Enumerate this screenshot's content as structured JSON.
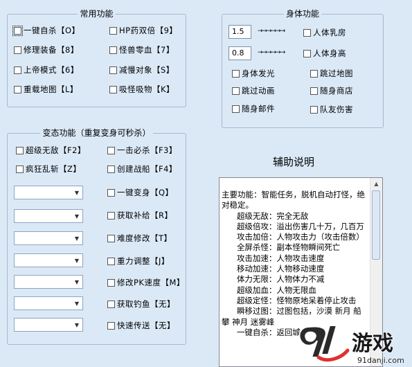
{
  "common": {
    "title": "常用功能",
    "items": [
      {
        "label": "一键自杀【O】",
        "checked": false
      },
      {
        "label": "HP药双倍【9】",
        "checked": false
      },
      {
        "label": "修理装备【8】",
        "checked": false
      },
      {
        "label": "怪兽零血【7】",
        "checked": false
      },
      {
        "label": "上帝模式【6】",
        "checked": false
      },
      {
        "label": "减慢对象【S】",
        "checked": false
      },
      {
        "label": "重载地图【L】",
        "checked": false
      },
      {
        "label": "吸怪吸物【K】",
        "checked": false
      }
    ]
  },
  "body_func": {
    "title": "身体功能",
    "breast_value": "1.5",
    "height_value": "0.8",
    "arrows": "→→→→→→",
    "items": [
      {
        "label": "人体乳房",
        "checked": false
      },
      {
        "label": "人体身高",
        "checked": false
      },
      {
        "label": "身体发光",
        "checked": false
      },
      {
        "label": "跳过地图",
        "checked": false
      },
      {
        "label": "跳过动画",
        "checked": false
      },
      {
        "label": "随身商店",
        "checked": false
      },
      {
        "label": "随身邮件",
        "checked": false
      },
      {
        "label": "队友伤害",
        "checked": false
      }
    ]
  },
  "abnormal": {
    "title": "变态功能（重复变身可秒杀）",
    "items": [
      {
        "label": "超级无敌【F2】",
        "checked": false
      },
      {
        "label": "一击必杀【F3】",
        "checked": false
      },
      {
        "label": "疯狂乱斩【Z】",
        "checked": false
      },
      {
        "label": "创建战船【F4】",
        "checked": false
      },
      {
        "label": "一键变身【Q】",
        "checked": false
      },
      {
        "label": "获取补给【R】",
        "checked": false
      },
      {
        "label": "难度修改【T】",
        "checked": false
      },
      {
        "label": "重力调整【J】",
        "checked": false
      },
      {
        "label": "修改PK速度【M】",
        "checked": false
      },
      {
        "label": "获取钓鱼【无】",
        "checked": false
      },
      {
        "label": "快速传送【无】",
        "checked": false
      }
    ],
    "combo_values": [
      "",
      "",
      "",
      "",
      "",
      "",
      "",
      ""
    ]
  },
  "help": {
    "title": "辅助说明",
    "text": "主要功能：智能任务，脱机自动打怪，绝对稳定。\n      超级无敌：完全无敌\n      超级倍攻：溢出伤害几十万，几百万\n      攻击加倍：人物攻击力（攻击倍数）\n      全屏杀怪：副本怪物瞬间死亡\n      攻击加速：人物攻击速度\n      移动加速：人物移动速度\n      体力无限：人物体力不减\n      超级加血：人物无限血\n      超级定怪：怪物原地呆着停止攻击\n      瞬移过图：过图包括，沙漠 新月 船 攀 神月 迷雾峰\n      一键自杀：返回城"
  },
  "watermark": {
    "brand": "91游戏",
    "site": "91danji.com"
  }
}
